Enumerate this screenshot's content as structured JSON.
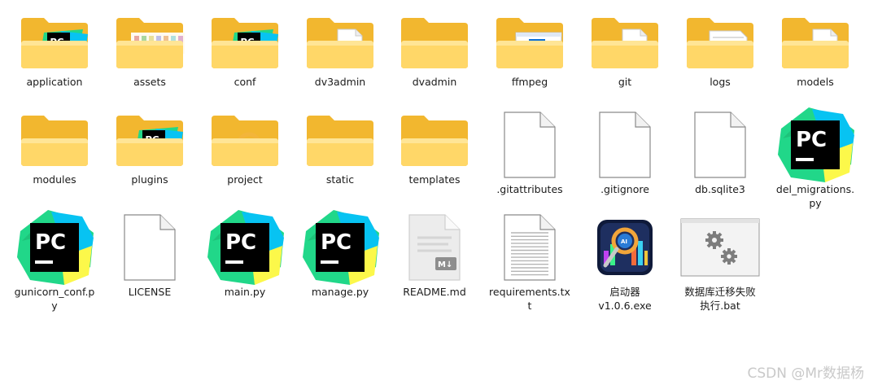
{
  "items": [
    {
      "name": "application",
      "type": "folder",
      "preview": "pycharm"
    },
    {
      "name": "assets",
      "type": "folder",
      "preview": "images"
    },
    {
      "name": "conf",
      "type": "folder",
      "preview": "pycharm"
    },
    {
      "name": "dv3admin",
      "type": "folder",
      "preview": "doc"
    },
    {
      "name": "dvadmin",
      "type": "folder",
      "preview": "none"
    },
    {
      "name": "ffmpeg",
      "type": "folder",
      "preview": "window"
    },
    {
      "name": "git",
      "type": "folder",
      "preview": "doc"
    },
    {
      "name": "logs",
      "type": "folder",
      "preview": "sheet"
    },
    {
      "name": "models",
      "type": "folder",
      "preview": "doc"
    },
    {
      "name": "modules",
      "type": "folder",
      "preview": "none"
    },
    {
      "name": "plugins",
      "type": "folder",
      "preview": "pycharm"
    },
    {
      "name": "project",
      "type": "folder",
      "preview": "ring"
    },
    {
      "name": "static",
      "type": "folder",
      "preview": "none"
    },
    {
      "name": "templates",
      "type": "folder",
      "preview": "none"
    },
    {
      "name": ".gitattributes",
      "type": "file"
    },
    {
      "name": ".gitignore",
      "type": "file"
    },
    {
      "name": "db.sqlite3",
      "type": "file"
    },
    {
      "name": "del_migrations.py",
      "type": "python"
    },
    {
      "name": "gunicorn_conf.py",
      "type": "python"
    },
    {
      "name": "LICENSE",
      "type": "file"
    },
    {
      "name": "main.py",
      "type": "python"
    },
    {
      "name": "manage.py",
      "type": "python"
    },
    {
      "name": "README.md",
      "type": "markdown"
    },
    {
      "name": "requirements.txt",
      "type": "text"
    },
    {
      "name": "启动器v1.0.6.exe",
      "type": "exe"
    },
    {
      "name": "数据库迁移失败执行.bat",
      "type": "bat"
    }
  ],
  "labels": {
    "exe": "启动器\nv1.0.6.exe",
    "bat": "数据库迁移失败\n执行.bat",
    "del": "del_migrations.\npy",
    "gunicorn": "gunicorn_conf.p\ny",
    "requirements": "requirements.tx\nt",
    "pycharm_badge": "PC",
    "markdown_badge": "M↓"
  },
  "watermark": "CSDN @Mr数据杨",
  "colors": {
    "folder_back": "#F2B72F",
    "folder_front": "#FFD768",
    "pycharm_black": "#000000",
    "pycharm_green": "#21D789",
    "pycharm_yellow": "#FCF84A",
    "pycharm_blue": "#07C3F2"
  }
}
